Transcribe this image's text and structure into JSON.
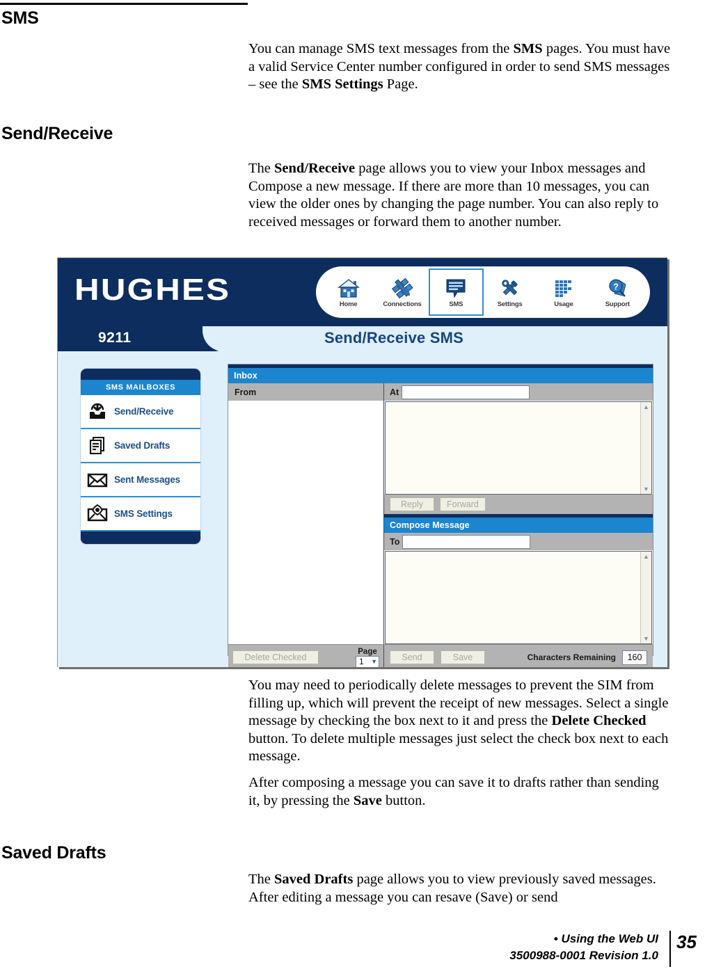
{
  "document": {
    "headings": {
      "sms": "SMS",
      "send_receive": "Send/Receive",
      "saved_drafts": "Saved Drafts"
    },
    "paragraphs": {
      "p1_a": "You can manage SMS text messages from the ",
      "p1_b": "SMS",
      "p1_c": " pages. You must have a valid Service Center number configured in order to send SMS messages – see the ",
      "p1_d": "SMS Settings",
      "p1_e": " Page.",
      "p2_a": "The ",
      "p2_b": "Send/Receive",
      "p2_c": " page allows you to view your Inbox messages and Compose a new message. If there are more than 10 messages, you can view the older ones by changing the page number. You can also reply to received messages or forward them to another number.",
      "p3_a": "You may need to periodically delete messages to prevent the SIM from filling up, which will prevent the receipt of new messages. Select a single message by checking the box next to it and press the ",
      "p3_b": "Delete Checked",
      "p3_c": " button.  To delete multiple messages just select the check box next to each message.",
      "p4_a": "After composing a message you can save it to drafts rather than sending it, by pressing the ",
      "p4_b": "Save",
      "p4_c": " button.",
      "p5_a": "The ",
      "p5_b": "Saved Drafts",
      "p5_c": " page allows you to view previously saved messages. After editing a message you can resave (Save) or send"
    },
    "footer": {
      "bullet": "•",
      "line1": " Using the Web UI",
      "line2": "3500988-0001  Revision 1.0",
      "page_number": "35"
    }
  },
  "screenshot": {
    "brand": "HUGHES",
    "device_model": "9211",
    "page_title": "Send/Receive SMS",
    "nav": [
      {
        "label": "Home",
        "icon": "home-icon",
        "active": false
      },
      {
        "label": "Connections",
        "icon": "satellite-icon",
        "active": false
      },
      {
        "label": "SMS",
        "icon": "message-bubble-icon",
        "active": true
      },
      {
        "label": "Settings",
        "icon": "tools-icon",
        "active": false
      },
      {
        "label": "Usage",
        "icon": "bar-grid-icon",
        "active": false
      },
      {
        "label": "Support",
        "icon": "question-magnifier-icon",
        "active": false
      }
    ],
    "sidebar": {
      "title": "SMS MAILBOXES",
      "items": [
        {
          "label": "Send/Receive",
          "icon": "inbox-download-icon"
        },
        {
          "label": "Saved Drafts",
          "icon": "documents-icon"
        },
        {
          "label": "Sent Messages",
          "icon": "envelope-icon"
        },
        {
          "label": "SMS Settings",
          "icon": "envelope-gear-icon"
        }
      ]
    },
    "inbox": {
      "panel_title": "Inbox",
      "from_header": "From",
      "at_label": "At",
      "at_value": "",
      "reply_button": "Reply",
      "forward_button": "Forward"
    },
    "compose": {
      "panel_title": "Compose Message",
      "to_label": "To",
      "to_value": "",
      "body_value": "",
      "send_button": "Send",
      "save_button": "Save",
      "characters_remaining_label": "Characters Remaining",
      "characters_remaining_value": "160"
    },
    "footer_controls": {
      "delete_checked_button": "Delete Checked",
      "page_label": "Page",
      "page_value": "1"
    },
    "colors": {
      "header_navy": "#0d2d5e",
      "accent_blue": "#1b85d0",
      "page_bg": "#dff0fb",
      "grey_bar": "#b3b3b3"
    }
  }
}
